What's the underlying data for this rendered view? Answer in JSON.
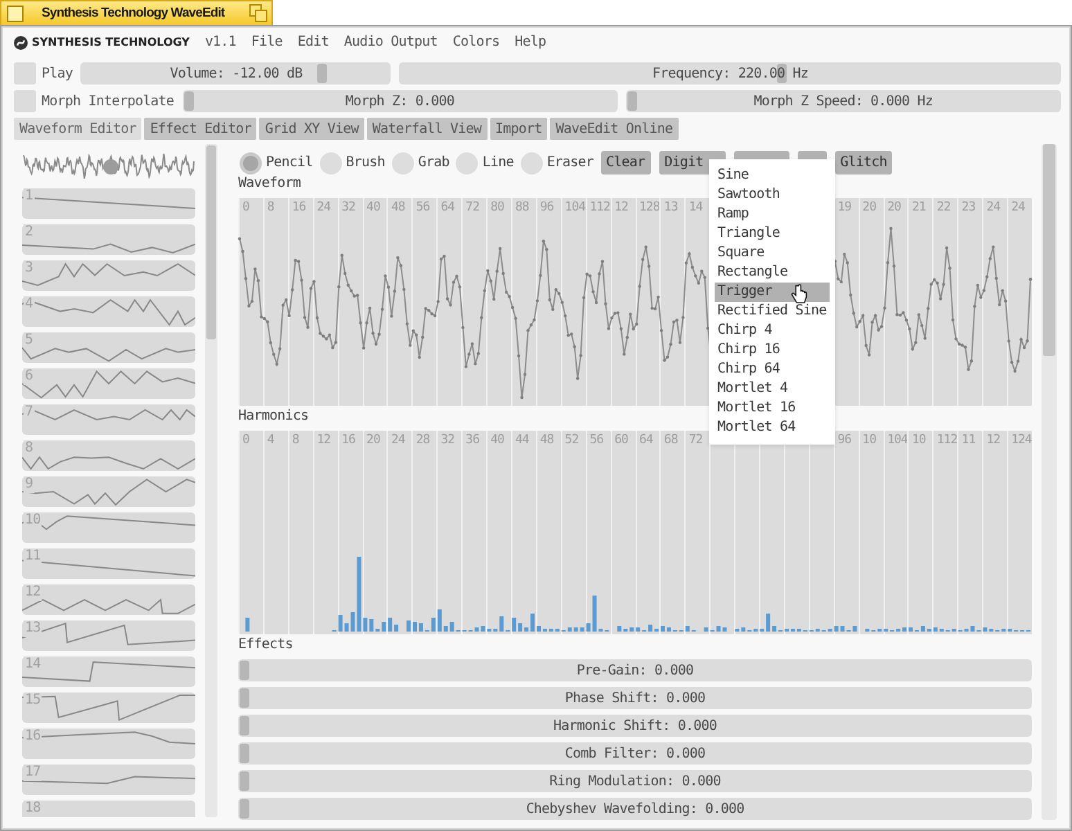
{
  "title_bar": {
    "title": "Synthesis Technology WaveEdit"
  },
  "menu_bar": {
    "brand": "SYNTHESIS TECHNOLOGY",
    "version": "v1.1",
    "items": [
      "File",
      "Edit",
      "Audio Output",
      "Colors",
      "Help"
    ]
  },
  "playback": {
    "play": {
      "label": "Play",
      "checked": false
    },
    "volume": {
      "label": "Volume: -12.00 dB",
      "level": 0.79
    },
    "frequency": {
      "label": "Frequency: 220.00 Hz",
      "level": 0.58
    }
  },
  "morph": {
    "interpolate": {
      "label": "Morph Interpolate",
      "checked": false
    },
    "morph_z": {
      "label": "Morph Z: 0.000",
      "level": 0
    },
    "morph_z_speed": {
      "label": "Morph Z Speed: 0.000 Hz",
      "level": 0
    }
  },
  "tabs": [
    {
      "label": "Waveform Editor",
      "selected": true
    },
    {
      "label": "Effect Editor",
      "selected": false
    },
    {
      "label": "Grid XY View",
      "selected": false
    },
    {
      "label": "Waterfall View",
      "selected": false
    },
    {
      "label": "Import",
      "selected": false
    },
    {
      "label": "WaveEdit Online",
      "selected": false
    }
  ],
  "waveform_list": {
    "items": [
      {
        "number": "1"
      },
      {
        "number": "2"
      },
      {
        "number": "3"
      },
      {
        "number": "4"
      },
      {
        "number": "5"
      },
      {
        "number": "6"
      },
      {
        "number": "7"
      },
      {
        "number": "8"
      },
      {
        "number": "9"
      },
      {
        "number": "10"
      },
      {
        "number": "11"
      },
      {
        "number": "12"
      },
      {
        "number": "13"
      },
      {
        "number": "14"
      },
      {
        "number": "15"
      },
      {
        "number": "16"
      },
      {
        "number": "17"
      },
      {
        "number": "18"
      }
    ]
  },
  "tools": [
    {
      "label": "Pencil",
      "selected": true
    },
    {
      "label": "Brush",
      "selected": false
    },
    {
      "label": "Grab",
      "selected": false
    },
    {
      "label": "Line",
      "selected": false
    },
    {
      "label": "Eraser",
      "selected": false
    }
  ],
  "actions": [
    {
      "kind": "button",
      "label": "Clear"
    },
    {
      "kind": "button",
      "label": "Digit"
    },
    {
      "kind": "covered"
    },
    {
      "kind": "covered"
    },
    {
      "kind": "button",
      "label": "Glitch"
    }
  ],
  "waveform_menu": {
    "items": [
      {
        "label": "Sine",
        "selected": false
      },
      {
        "label": "Sawtooth",
        "selected": false
      },
      {
        "label": "Ramp",
        "selected": false
      },
      {
        "label": "Triangle",
        "selected": false
      },
      {
        "label": "Square",
        "selected": false
      },
      {
        "label": "Rectangle",
        "selected": false
      },
      {
        "label": "Trigger",
        "selected": true
      },
      {
        "label": "Rectified Sine",
        "selected": false
      },
      {
        "label": "Chirp 4",
        "selected": false
      },
      {
        "label": "Chirp 16",
        "selected": false
      },
      {
        "label": "Chirp 64",
        "selected": false
      },
      {
        "label": "Mortlet 4",
        "selected": false
      },
      {
        "label": "Mortlet 16",
        "selected": false
      },
      {
        "label": "Mortlet 64",
        "selected": false
      }
    ]
  },
  "waveform": {
    "title": "Waveform",
    "column_labels_before_menu": [
      "0",
      "8",
      "16",
      "24",
      "32",
      "40",
      "48",
      "56",
      "64",
      "72",
      "80",
      "88",
      "96",
      "104",
      "112",
      "12",
      "128",
      "13",
      "14"
    ],
    "column_labels_after_menu": [
      "19",
      "20",
      "20",
      "21",
      "22",
      "23",
      "24",
      "24"
    ]
  },
  "harmonics": {
    "title": "Harmonics",
    "column_labels_before_menu": [
      "0",
      "4",
      "8",
      "12",
      "16",
      "20",
      "24",
      "28",
      "32",
      "36",
      "40",
      "44",
      "48",
      "52",
      "56",
      "60",
      "64",
      "68",
      "72"
    ],
    "column_labels_after_menu": [
      "96",
      "10",
      "104",
      "10",
      "112",
      "11",
      "12",
      "124"
    ]
  },
  "effects": {
    "title": "Effects",
    "sliders": [
      {
        "label": "Pre-Gain: 0.000",
        "level": 0
      },
      {
        "label": "Phase Shift: 0.000",
        "level": 0
      },
      {
        "label": "Harmonic Shift: 0.000",
        "level": 0
      },
      {
        "label": "Comb Filter: 0.000",
        "level": 0
      },
      {
        "label": "Ring Modulation: 0.000",
        "level": 0
      },
      {
        "label": "Chebyshev Wavefolding: 0.000",
        "level": 0
      }
    ]
  }
}
